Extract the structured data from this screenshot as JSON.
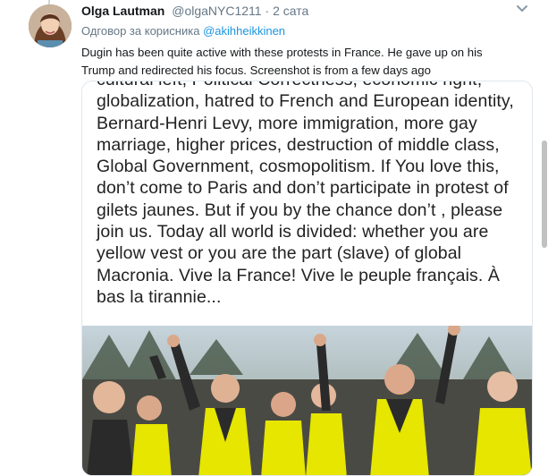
{
  "tweet": {
    "author_name": "Olga Lautman",
    "author_handle": "@olgaNYC1211",
    "separator": "·",
    "time": "2 сата",
    "reply_prefix": "Одговор за корисника",
    "reply_to": "@akihheikkinen",
    "text_lines": [
      "Dugin has been quite active with these protests in France. He gave up on his",
      "Trump and redirected his focus. Screenshot is from a few days ago"
    ]
  },
  "screenshot": {
    "lines": [
      "cultural left, Political Correctness, economic right,",
      "globalization, hatred to French and European identity,",
      "Bernard-Henri Levy, more immigration, more gay",
      "marriage, higher prices, destruction of middle class,",
      "Global Government, cosmopolitism. If You love this,",
      "don’t come to Paris and don’t participate in protest of",
      "gilets jaunes. But if you by the chance don’t , please",
      "join us. Today all world is divided: whether you are",
      "yellow vest or you are the part (slave) of global",
      "Macronia. Vive la France! Vive le peuple français. À",
      "bas la tirannie..."
    ]
  },
  "icons": {
    "menu": "chevron-down-icon"
  },
  "colors": {
    "link": "#1b95e0",
    "muted": "#657786",
    "text": "#14171a",
    "vest": "#e6e600"
  }
}
